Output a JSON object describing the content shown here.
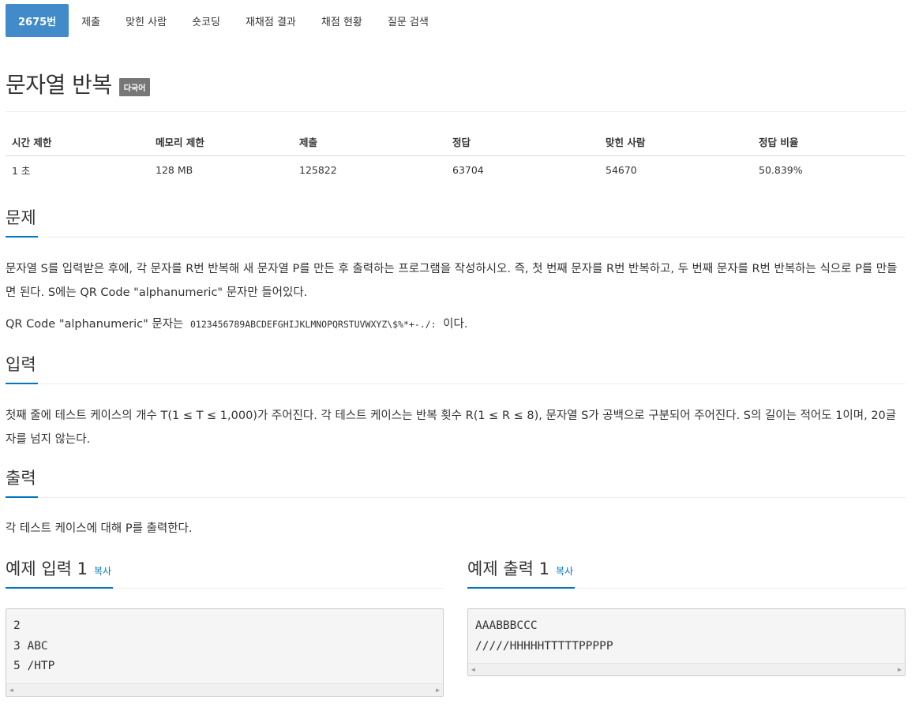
{
  "tabs": [
    {
      "label": "2675번",
      "active": true
    },
    {
      "label": "제출"
    },
    {
      "label": "맞힌 사람"
    },
    {
      "label": "숏코딩"
    },
    {
      "label": "재채점 결과"
    },
    {
      "label": "채점 현황"
    },
    {
      "label": "질문 검색"
    }
  ],
  "problem": {
    "title": "문자열 반복",
    "lang_label": "다국어"
  },
  "info_table": {
    "headers": [
      "시간 제한",
      "메모리 제한",
      "제출",
      "정답",
      "맞힌 사람",
      "정답 비율"
    ],
    "values": [
      "1 초",
      "128 MB",
      "125822",
      "63704",
      "54670",
      "50.839%"
    ]
  },
  "sections": {
    "description": {
      "title": "문제",
      "para1": "문자열 S를 입력받은 후에, 각 문자를 R번 반복해 새 문자열 P를 만든 후 출력하는 프로그램을 작성하시오. 즉, 첫 번째 문자를 R번 반복하고, 두 번째 문자를 R번 반복하는 식으로 P를 만들면 된다. S에는 QR Code \"alphanumeric\" 문자만 들어있다.",
      "para2_prefix": "QR Code \"alphanumeric\" 문자는",
      "para2_code": "0123456789ABCDEFGHIJKLMNOPQRSTUVWXYZ\\$%*+-./:",
      "para2_suffix": "이다."
    },
    "input": {
      "title": "입력",
      "text": "첫째 줄에 테스트 케이스의 개수 T(1 ≤ T ≤ 1,000)가 주어진다. 각 테스트 케이스는 반복 횟수 R(1 ≤ R ≤ 8), 문자열 S가 공백으로 구분되어 주어진다. S의 길이는 적어도 1이며, 20글자를 넘지 않는다."
    },
    "output": {
      "title": "출력",
      "text": "각 테스트 케이스에 대해 P를 출력한다."
    }
  },
  "samples": {
    "input": {
      "title": "예제 입력 1",
      "copy_label": "복사",
      "lines": [
        "2",
        "3 ABC",
        "5 /HTP"
      ]
    },
    "output": {
      "title": "예제 출력 1",
      "copy_label": "복사",
      "lines": [
        "AAABBBCCC",
        "/////HHHHHTTTTTPPPPP"
      ]
    }
  }
}
